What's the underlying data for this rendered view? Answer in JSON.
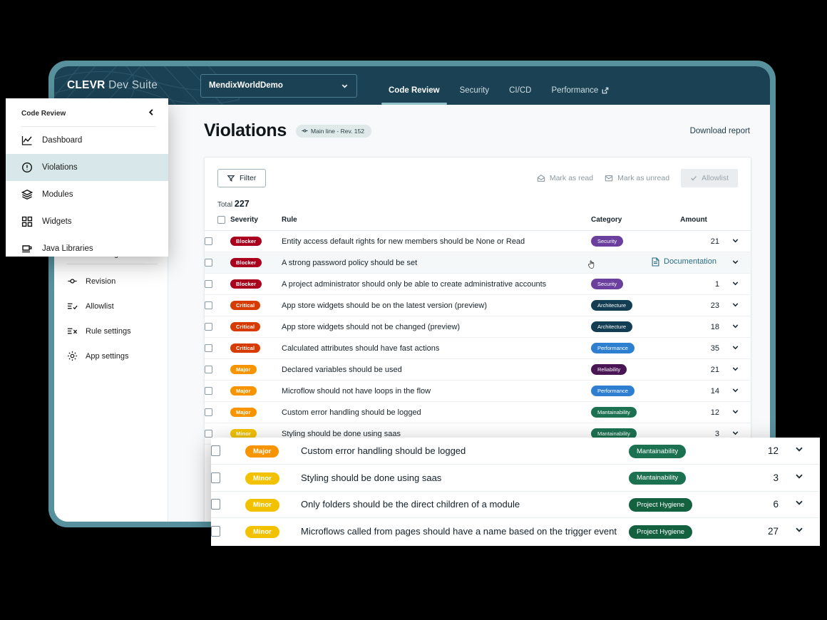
{
  "app": {
    "brand_strong": "CLEVR",
    "brand_light": "Dev Suite",
    "project": "MendixWorldDemo",
    "nav": [
      {
        "label": "Code Review",
        "active": true,
        "external": false
      },
      {
        "label": "Security",
        "active": false,
        "external": false
      },
      {
        "label": "CI/CD",
        "active": false,
        "external": false
      },
      {
        "label": "Performance",
        "active": false,
        "external": true
      }
    ]
  },
  "float_menu": {
    "title": "Code Review",
    "items": [
      {
        "label": "Dashboard",
        "icon": "chart-line-icon",
        "active": false
      },
      {
        "label": "Violations",
        "icon": "alert-circle-icon",
        "active": true
      },
      {
        "label": "Modules",
        "icon": "layers-icon",
        "active": false
      },
      {
        "label": "Widgets",
        "icon": "widgets-grid-icon",
        "active": false
      },
      {
        "label": "Java Libraries",
        "icon": "coffee-cup-icon",
        "active": false
      }
    ]
  },
  "rail": {
    "group_title": "General settings",
    "items": [
      {
        "label": "Revision",
        "icon": "revision-icon"
      },
      {
        "label": "Allowlist",
        "icon": "allowlist-icon"
      },
      {
        "label": "Rule settings",
        "icon": "rule-settings-icon"
      },
      {
        "label": "App settings",
        "icon": "gear-icon"
      }
    ]
  },
  "page": {
    "title": "Violations",
    "revision_badge": "Main line - Rev. 152",
    "download_report": "Download report"
  },
  "toolbar": {
    "filter": "Filter",
    "mark_as_read": "Mark as read",
    "mark_as_unread": "Mark as unread",
    "allowlist": "Allowlist"
  },
  "summary": {
    "total_label": "Total",
    "total_value": "227"
  },
  "table": {
    "headers": {
      "severity": "Severity",
      "rule": "Rule",
      "category": "Category",
      "amount": "Amount"
    },
    "rows": [
      {
        "severity": "Blocker",
        "rule": "Entity access default rights for new members should be None or Read",
        "category": "Security",
        "amount": "21",
        "hover": false,
        "doc": false
      },
      {
        "severity": "Blocker",
        "rule": "A strong password policy should be set",
        "category": "",
        "amount": "",
        "hover": true,
        "doc": true,
        "doc_label": "Documentation"
      },
      {
        "severity": "Blocker",
        "rule": "A project administrator should only be able to create administrative accounts",
        "category": "Security",
        "amount": "1",
        "hover": false,
        "doc": false
      },
      {
        "severity": "Critical",
        "rule": "App store widgets should be on the latest version (preview)",
        "category": "Architecture",
        "amount": "23",
        "hover": false,
        "doc": false
      },
      {
        "severity": "Critical",
        "rule": "App store widgets should not be changed (preview)",
        "category": "Architecture",
        "amount": "18",
        "hover": false,
        "doc": false
      },
      {
        "severity": "Critical",
        "rule": "Calculated attributes should have fast actions",
        "category": "Performance",
        "amount": "35",
        "hover": false,
        "doc": false
      },
      {
        "severity": "Major",
        "rule": "Declared variables should be used",
        "category": "Reliability",
        "amount": "21",
        "hover": false,
        "doc": false
      },
      {
        "severity": "Major",
        "rule": "Microflow should not have loops in the flow",
        "category": "Performance",
        "amount": "14",
        "hover": false,
        "doc": false
      },
      {
        "severity": "Major",
        "rule": "Custom error handling should be logged",
        "category": "Mantainability",
        "amount": "12",
        "hover": false,
        "doc": false
      },
      {
        "severity": "Minor",
        "rule": "Styling should be done using saas",
        "category": "Mantainability",
        "amount": "3",
        "hover": false,
        "doc": false
      }
    ]
  },
  "zoom_card": {
    "rows": [
      {
        "severity": "Major",
        "rule": "Custom error handling should be logged",
        "category": "Mantainability",
        "amount": "12"
      },
      {
        "severity": "Minor",
        "rule": "Styling should be done using saas",
        "category": "Mantainability",
        "amount": "3"
      },
      {
        "severity": "Minor",
        "rule": "Only folders should be the direct children of a module",
        "category": "Project Hygiene",
        "amount": "6"
      },
      {
        "severity": "Minor",
        "rule": "Microflows called from pages should have a name based on the trigger event",
        "category": "Project Hygiene",
        "amount": "27"
      }
    ]
  },
  "colors": {
    "header_bg": "#1b4254",
    "device_frame": "#57919d",
    "severity": {
      "Blocker": "#a8001d",
      "Critical": "#d83b00",
      "Major": "#f79400",
      "Minor": "#f2c200"
    },
    "category": {
      "Security": "#6b3f9e",
      "Architecture": "#123d52",
      "Performance": "#2f7fd1",
      "Reliability": "#4a1554",
      "Mantainability": "#1c7250",
      "Project Hygiene": "#14613f"
    },
    "accent": "#8fc0c9",
    "link": "#2a6b85"
  }
}
